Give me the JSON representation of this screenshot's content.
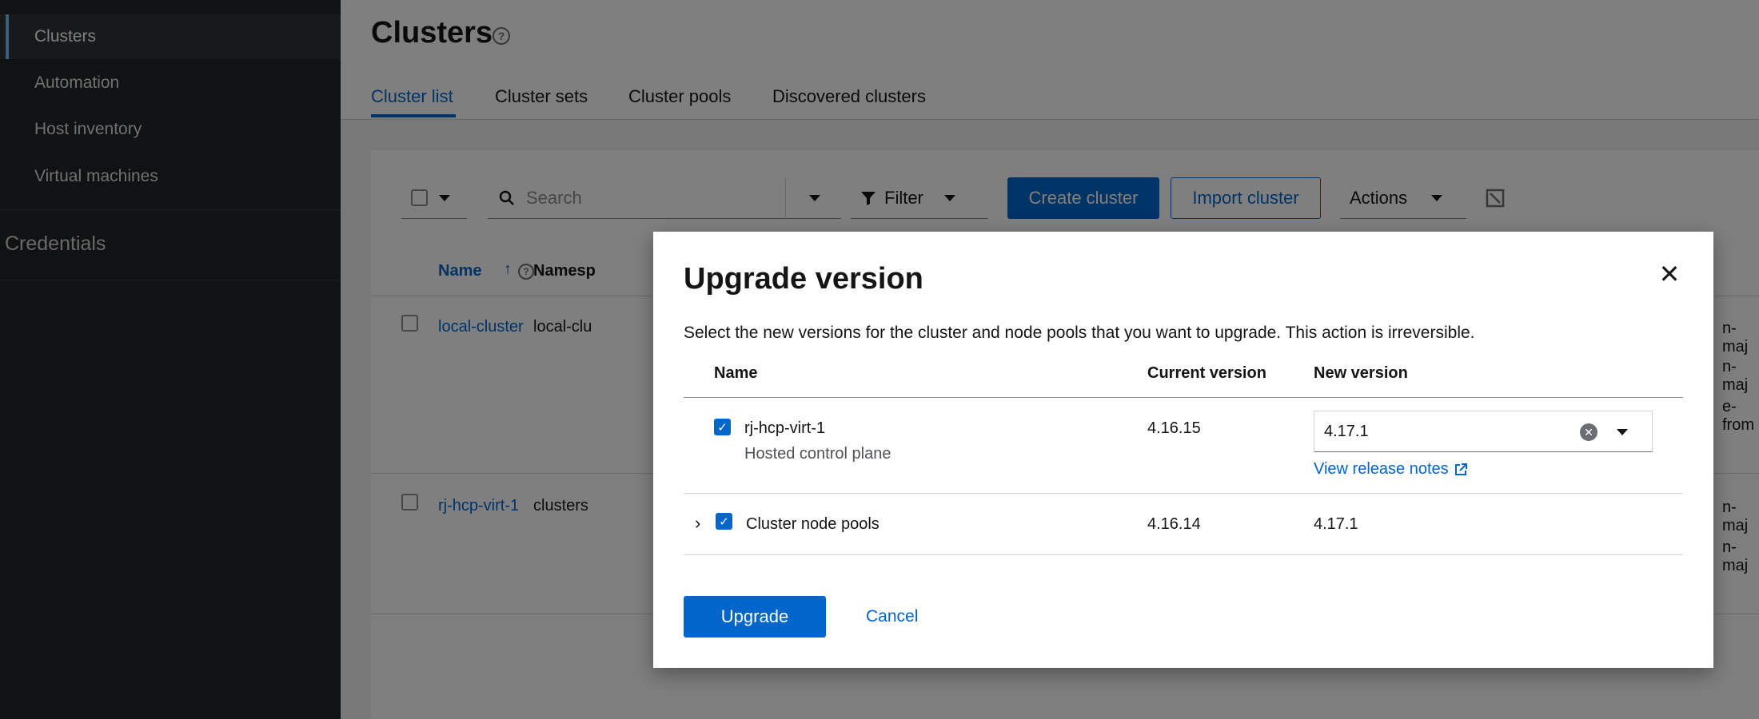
{
  "sidebar": {
    "items": [
      {
        "label": "Clusters",
        "active": true
      },
      {
        "label": "Automation"
      },
      {
        "label": "Host inventory"
      },
      {
        "label": "Virtual machines"
      }
    ],
    "section": "Credentials"
  },
  "page": {
    "title": "Clusters",
    "tabs": [
      "Cluster list",
      "Cluster sets",
      "Cluster pools",
      "Discovered clusters"
    ],
    "active_tab": "Cluster list"
  },
  "toolbar": {
    "search_placeholder": "Search",
    "filter_label": "Filter",
    "create_label": "Create cluster",
    "import_label": "Import cluster",
    "actions_label": "Actions"
  },
  "table": {
    "headers": {
      "name": "Name",
      "namespace": "Namesp"
    },
    "rows": [
      {
        "name": "local-cluster",
        "namespace": "local-clu",
        "trailing": [
          "n-maj",
          "n-maj",
          "e-from"
        ]
      },
      {
        "name": "rj-hcp-virt-1",
        "namespace": "clusters",
        "trailing": [
          "n-maj",
          "n-maj"
        ]
      }
    ]
  },
  "modal": {
    "title": "Upgrade version",
    "description": "Select the new versions for the cluster and node pools that you want to upgrade. This action is irreversible.",
    "columns": {
      "name": "Name",
      "current": "Current version",
      "new": "New version"
    },
    "rows": [
      {
        "name": "rj-hcp-virt-1",
        "sub": "Hosted control plane",
        "current": "4.16.15",
        "new": "4.17.1",
        "release_notes": "View release notes"
      },
      {
        "name": "Cluster node pools",
        "current": "4.16.14",
        "new": "4.17.1"
      }
    ],
    "upgrade_label": "Upgrade",
    "cancel_label": "Cancel"
  },
  "colors": {
    "accent": "#0066cc",
    "sidebar": "#212427"
  }
}
